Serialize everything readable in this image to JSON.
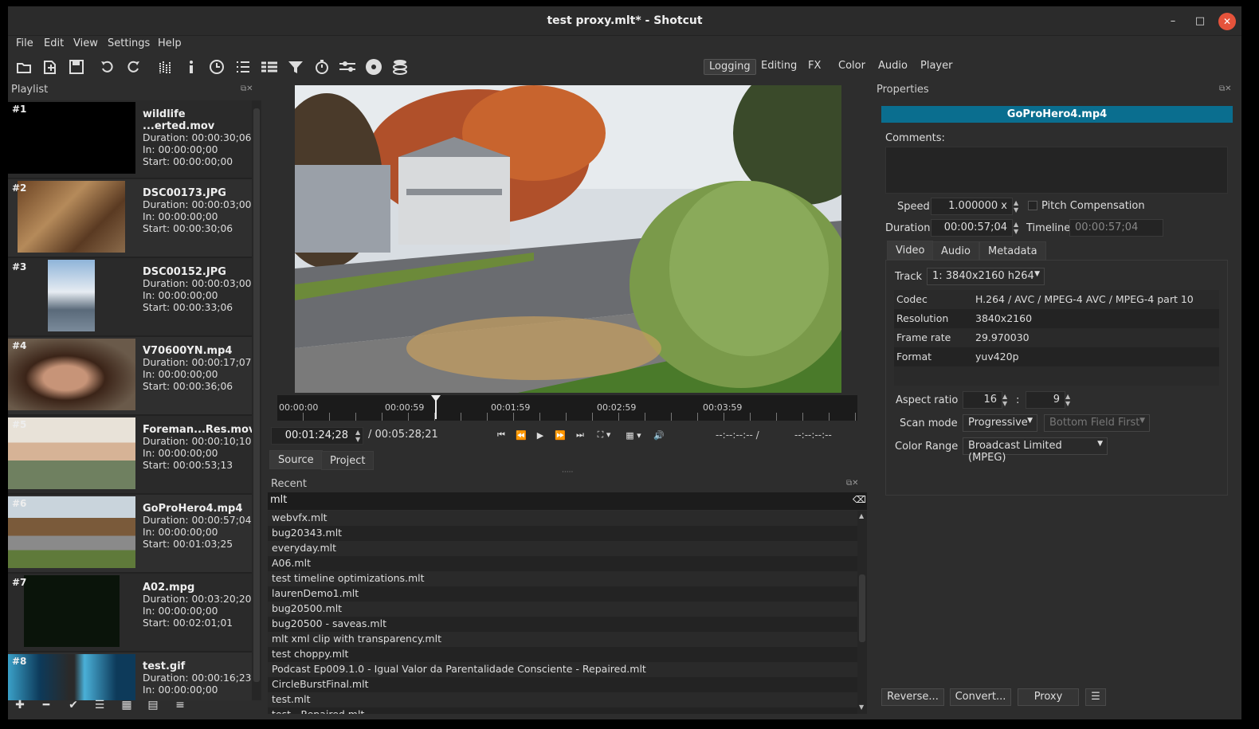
{
  "window": {
    "title": "test proxy.mlt* - Shotcut",
    "controls": {
      "minimize": "–",
      "maximize": "□",
      "close": "✕"
    }
  },
  "menu": [
    "File",
    "Edit",
    "View",
    "Settings",
    "Help"
  ],
  "toolbar": {
    "icons": [
      "open-file-icon",
      "open-other-icon",
      "save-icon",
      "undo-icon",
      "redo-icon",
      "peak-meter-icon",
      "properties-icon",
      "recent-icon",
      "playlist-icon",
      "timeline-icon",
      "filters-icon",
      "keyframes-icon",
      "history-icon",
      "encode-icon",
      "jobs-icon"
    ],
    "layouts": [
      "Logging",
      "Editing",
      "FX",
      "Color",
      "Audio",
      "Player"
    ],
    "active_layout": "Logging"
  },
  "playlist": {
    "title": "Playlist",
    "items": [
      {
        "num": "#1",
        "name": "wildlife ...erted.mov",
        "duration": "Duration: 00:00:30;06",
        "in": "In: 00:00:00;00",
        "start": "Start: 00:00:00;00"
      },
      {
        "num": "#2",
        "name": "DSC00173.JPG",
        "duration": "Duration: 00:00:03;00",
        "in": "In: 00:00:00;00",
        "start": "Start: 00:00:30;06"
      },
      {
        "num": "#3",
        "name": "DSC00152.JPG",
        "duration": "Duration: 00:00:03;00",
        "in": "In: 00:00:00;00",
        "start": "Start: 00:00:33;06"
      },
      {
        "num": "#4",
        "name": "V70600YN.mp4",
        "duration": "Duration: 00:00:17;07",
        "in": "In: 00:00:00;00",
        "start": "Start: 00:00:36;06"
      },
      {
        "num": "#5",
        "name": "Foreman...Res.mov",
        "duration": "Duration: 00:00:10;10",
        "in": "In: 00:00:00;00",
        "start": "Start: 00:00:53;13"
      },
      {
        "num": "#6",
        "name": "GoProHero4.mp4",
        "duration": "Duration: 00:00:57;04",
        "in": "In: 00:00:00;00",
        "start": "Start: 00:01:03;25"
      },
      {
        "num": "#7",
        "name": "A02.mpg",
        "duration": "Duration: 00:03:20;20",
        "in": "In: 00:00:00;00",
        "start": "Start: 00:02:01;01"
      },
      {
        "num": "#8",
        "name": "test.gif",
        "duration": "Duration: 00:00:16;23",
        "in": "In: 00:00:00;00",
        "start": ""
      }
    ],
    "bottom_buttons": [
      "add-icon",
      "remove-icon",
      "update-icon",
      "details-view-icon",
      "tiles-view-icon",
      "icons-view-icon",
      "menu-icon"
    ]
  },
  "player": {
    "ruler_labels": [
      "00:00:00",
      "00:00:59",
      "00:01:59",
      "00:02:59",
      "00:03:59"
    ],
    "timecode": "00:01:24;28",
    "total": "/ 00:05:28;21",
    "in_point": "--:--:--:-- /",
    "out_point": "--:--:--:--",
    "tabs": [
      "Source",
      "Project"
    ],
    "active_tab": "Source"
  },
  "recent": {
    "title": "Recent",
    "filter": "mlt",
    "items": [
      "webvfx.mlt",
      "bug20343.mlt",
      "everyday.mlt",
      "A06.mlt",
      "test timeline optimizations.mlt",
      "laurenDemo1.mlt",
      "bug20500.mlt",
      "bug20500 - saveas.mlt",
      "mlt xml clip with transparency.mlt",
      "test choppy.mlt",
      "Podcast Ep009.1.0 - Igual Valor da Parentalidade Consciente - Repaired.mlt",
      "CircleBurstFinal.mlt",
      "test.mlt",
      "test - Repaired.mlt"
    ]
  },
  "properties": {
    "title": "Properties",
    "clip_name": "GoProHero4.mp4",
    "comments_label": "Comments:",
    "speed_label": "Speed",
    "speed_value": "1.000000 x",
    "pitch_label": "Pitch Compensation",
    "duration_label": "Duration",
    "duration_value": "00:00:57;04",
    "timeline_label": "Timeline",
    "timeline_value": "00:00:57;04",
    "tabs": [
      "Video",
      "Audio",
      "Metadata"
    ],
    "active_tab": "Video",
    "track_label": "Track",
    "track_value": "1: 3840x2160 h264",
    "info": [
      {
        "k": "Codec",
        "v": "H.264 / AVC / MPEG-4 AVC / MPEG-4 part 10"
      },
      {
        "k": "Resolution",
        "v": "3840x2160"
      },
      {
        "k": "Frame rate",
        "v": "29.970030"
      },
      {
        "k": "Format",
        "v": "yuv420p"
      }
    ],
    "aspect_label": "Aspect ratio",
    "aspect_w": "16",
    "aspect_sep": ":",
    "aspect_h": "9",
    "scan_label": "Scan mode",
    "scan_value": "Progressive",
    "field_order": "Bottom Field First",
    "color_range_label": "Color Range",
    "color_range_value": "Broadcast Limited (MPEG)",
    "buttons": {
      "reverse": "Reverse...",
      "convert": "Convert...",
      "proxy": "Proxy",
      "menu": "☰"
    }
  },
  "colors": {
    "accent": "#0a6e8f",
    "window_bg": "#2d2d2d",
    "close": "#e5533b"
  }
}
